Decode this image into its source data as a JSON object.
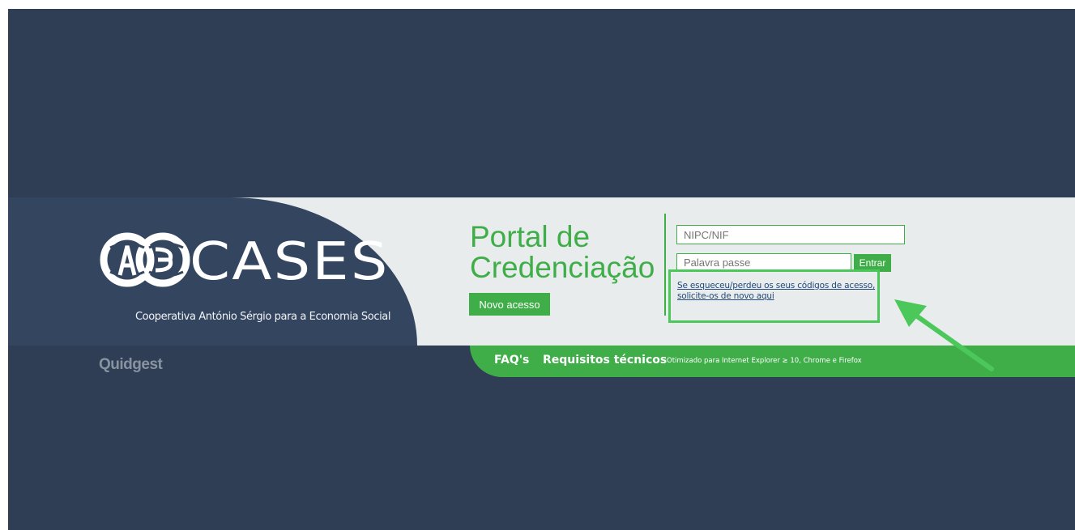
{
  "brand": {
    "name": "CASES",
    "subtitle": "Cooperativa António Sérgio para a Economia Social"
  },
  "portal": {
    "title_line1": "Portal de",
    "title_line2": "Credenciação",
    "new_access_label": "Novo acesso"
  },
  "login": {
    "nif_placeholder": "NIPC/NIF",
    "password_placeholder": "Palavra passe",
    "enter_label": "Entrar",
    "forgot_line1": "Se esqueceu/perdeu os seus códigos de acesso,",
    "forgot_line2": "solicite-os de novo aqui"
  },
  "footer": {
    "faq_label": "FAQ's",
    "requirements_label": "Requisitos técnicos",
    "browser_note": "Otimizado para Internet Explorer ≥ 10, Chrome e Firefox"
  },
  "vendor": {
    "name": "Quidgest"
  },
  "colors": {
    "page_background": "#2f3d55",
    "band_background": "#e8eced",
    "logo_panel": "#34455f",
    "accent_green": "#3fae49",
    "highlight_green": "#4cc85b",
    "link_blue": "#234a7a"
  }
}
